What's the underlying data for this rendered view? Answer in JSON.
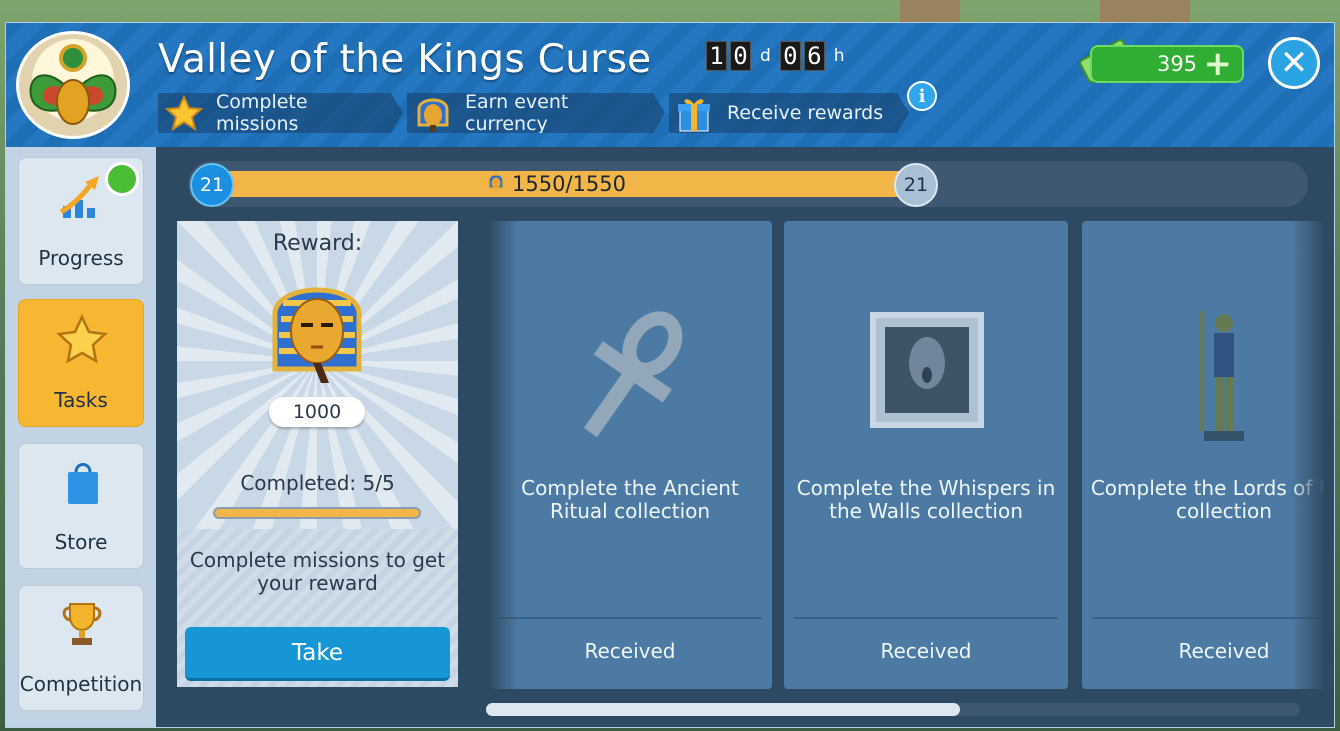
{
  "header": {
    "title": "Valley of the Kings Curse",
    "timer": {
      "d1": "1",
      "d2": "0",
      "day_unit": "d",
      "h1": "0",
      "h2": "6",
      "hour_unit": "h"
    },
    "steps": [
      {
        "label": "Complete missions",
        "icon": "star-icon"
      },
      {
        "label": "Earn event currency",
        "icon": "pharaoh-mask-icon"
      },
      {
        "label": "Receive rewards",
        "icon": "gift-icon"
      }
    ],
    "currency": {
      "value": "395",
      "icon": "cash-icon"
    },
    "colors": {
      "header": "#1f6fb6",
      "accent": "#f7b733",
      "button": "#1796d6",
      "currency": "#2fae33"
    }
  },
  "sidebar": {
    "items": [
      {
        "label": "Progress",
        "icon": "progress-chart-icon",
        "active": false
      },
      {
        "label": "Tasks",
        "icon": "star-icon",
        "active": true
      },
      {
        "label": "Store",
        "icon": "shopping-bag-icon",
        "active": false
      },
      {
        "label": "Competition",
        "icon": "trophy-icon",
        "active": false
      }
    ]
  },
  "progress": {
    "level_current": "21",
    "level_next": "21",
    "text": "1550/1550",
    "fraction": 1.0
  },
  "reward": {
    "title": "Reward:",
    "amount": "1000",
    "completed": "Completed: 5/5",
    "completed_fraction": 1.0,
    "hint": "Complete missions to get your reward",
    "take_label": "Take"
  },
  "tasks": [
    {
      "label": "Complete the Ancient Ritual collection",
      "status": "Received",
      "icon": "ankh-icon"
    },
    {
      "label": "Complete the Whispers in the Walls collection",
      "status": "Received",
      "icon": "ghost-frame-icon"
    },
    {
      "label": "Complete the Lords of Nile collection",
      "status": "Received",
      "icon": "statue-icon"
    }
  ]
}
